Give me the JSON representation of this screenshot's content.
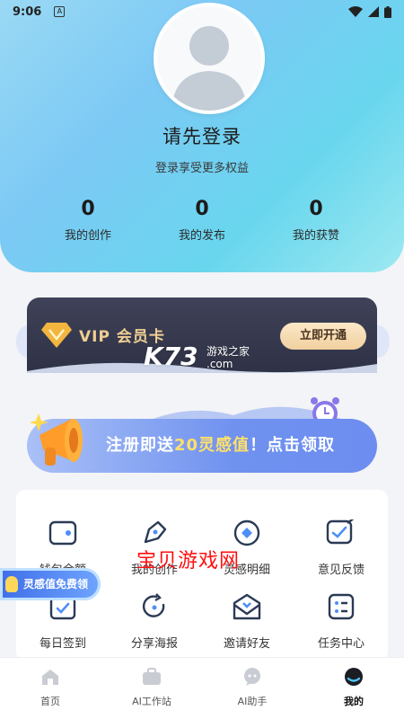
{
  "status_bar": {
    "time": "9:06",
    "app_indicator": "A"
  },
  "profile": {
    "login_title": "请先登录",
    "login_subtitle": "登录享受更多权益",
    "stats": [
      {
        "value": "0",
        "label": "我的创作"
      },
      {
        "value": "0",
        "label": "我的发布"
      },
      {
        "value": "0",
        "label": "我的获赞"
      }
    ]
  },
  "vip": {
    "label": "VIP 会员卡",
    "button": "立即开通"
  },
  "watermark_k73": {
    "main": "K73",
    "sub_line1": "游戏之家",
    "sub_line2": ".com"
  },
  "promo": {
    "text_prefix": "注册即送",
    "highlight": "20灵感值",
    "text_suffix": "！点击领取"
  },
  "menu": {
    "items": [
      {
        "label": "钱包余额",
        "icon": "wallet-icon"
      },
      {
        "label": "我的创作",
        "icon": "pen-nib-icon"
      },
      {
        "label": "灵感明细",
        "icon": "diamond-icon"
      },
      {
        "label": "意见反馈",
        "icon": "feedback-icon"
      },
      {
        "label": "每日签到",
        "icon": "checkin-icon"
      },
      {
        "label": "分享海报",
        "icon": "share-icon"
      },
      {
        "label": "邀请好友",
        "icon": "invite-mail-icon"
      },
      {
        "label": "任务中心",
        "icon": "task-list-icon"
      }
    ]
  },
  "watermark_cn": "宝贝游戏网",
  "float_badge": "灵感值免费领",
  "tabbar": {
    "tabs": [
      {
        "label": "首页",
        "icon": "home-icon"
      },
      {
        "label": "AI工作站",
        "icon": "briefcase-icon"
      },
      {
        "label": "AI助手",
        "icon": "chat-bubble-icon"
      },
      {
        "label": "我的",
        "icon": "profile-icon",
        "active": true
      }
    ]
  },
  "colors": {
    "header_start": "#9ad9f4",
    "header_end": "#69d6ee",
    "vip_gold": "#f0cf93",
    "promo_blue": "#6f91ef",
    "watermark_red": "#ff1010"
  }
}
